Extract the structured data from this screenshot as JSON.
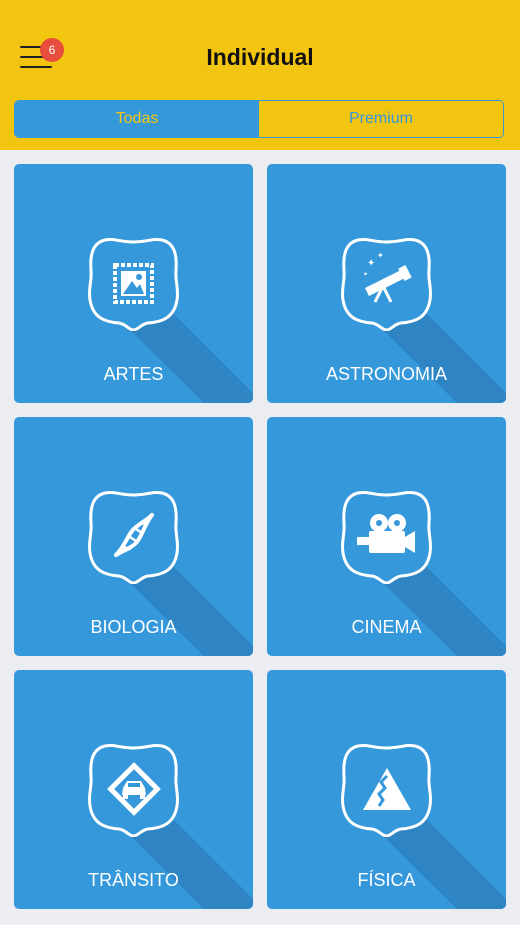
{
  "header": {
    "title": "Individual",
    "notification_count": "6",
    "bg_color": "#f2c511"
  },
  "tabs": [
    {
      "label": "Todas",
      "active": true
    },
    {
      "label": "Premium",
      "active": false
    }
  ],
  "categories": [
    {
      "label": "ARTES",
      "icon": "stamp-picture-icon"
    },
    {
      "label": "ASTRONOMIA",
      "icon": "telescope-icon"
    },
    {
      "label": "BIOLOGIA",
      "icon": "dna-icon"
    },
    {
      "label": "CINEMA",
      "icon": "movie-camera-icon"
    },
    {
      "label": "TRÂNSITO",
      "icon": "car-road-sign-icon"
    },
    {
      "label": "FÍSICA",
      "icon": "mountain-icon"
    }
  ],
  "colors": {
    "card_blue": "#3498db",
    "shadow_blue": "#2f85c4",
    "badge_red": "#e74c3c",
    "background": "#ebedf0"
  }
}
